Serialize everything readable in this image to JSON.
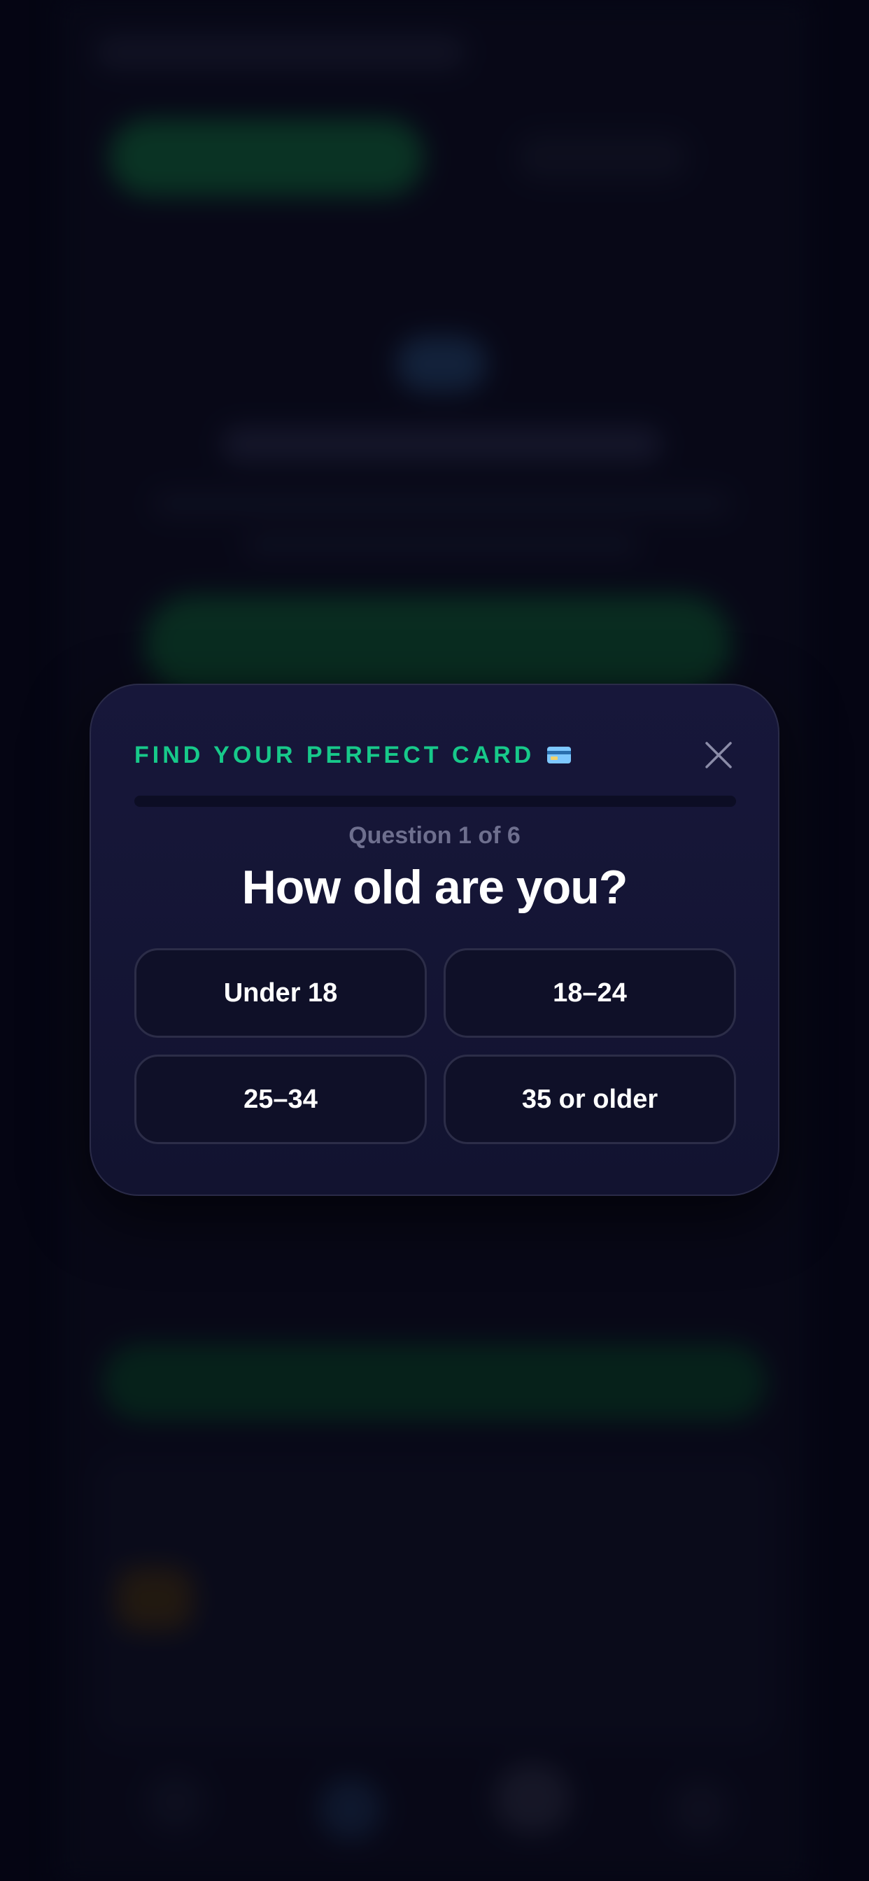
{
  "modal": {
    "title": "FIND YOUR PERFECT CARD",
    "title_icon": "credit-card-icon",
    "close_icon": "close-icon",
    "progress": {
      "current": 1,
      "total": 6,
      "fill_fraction": 0.0
    },
    "question_counter": "Question 1 of 6",
    "question": "How old are you?",
    "options": [
      {
        "label": "Under 18"
      },
      {
        "label": "18–24"
      },
      {
        "label": "25–34"
      },
      {
        "label": "35 or older"
      }
    ]
  },
  "colors": {
    "accent": "#17c98a",
    "modal_bg": "#17173a",
    "option_border": "#2c2d48",
    "counter_text": "#6e6f8e"
  }
}
